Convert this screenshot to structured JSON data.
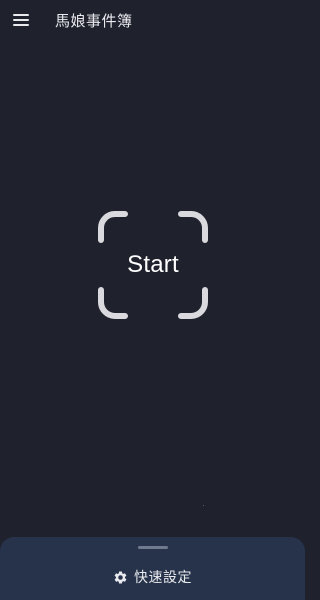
{
  "app_bar": {
    "menu_icon": "hamburger-menu-icon",
    "title": "馬娘事件簿"
  },
  "main": {
    "start_label": "Start",
    "scan_frame_icon": "scan-frame-icon"
  },
  "bottom_sheet": {
    "quick_settings_icon": "gear-icon",
    "quick_settings_label": "快速設定"
  },
  "colors": {
    "background": "#1f212d",
    "sheet_background": "#26334a",
    "frame": "#d9d9de",
    "text": "#e9eaee"
  }
}
